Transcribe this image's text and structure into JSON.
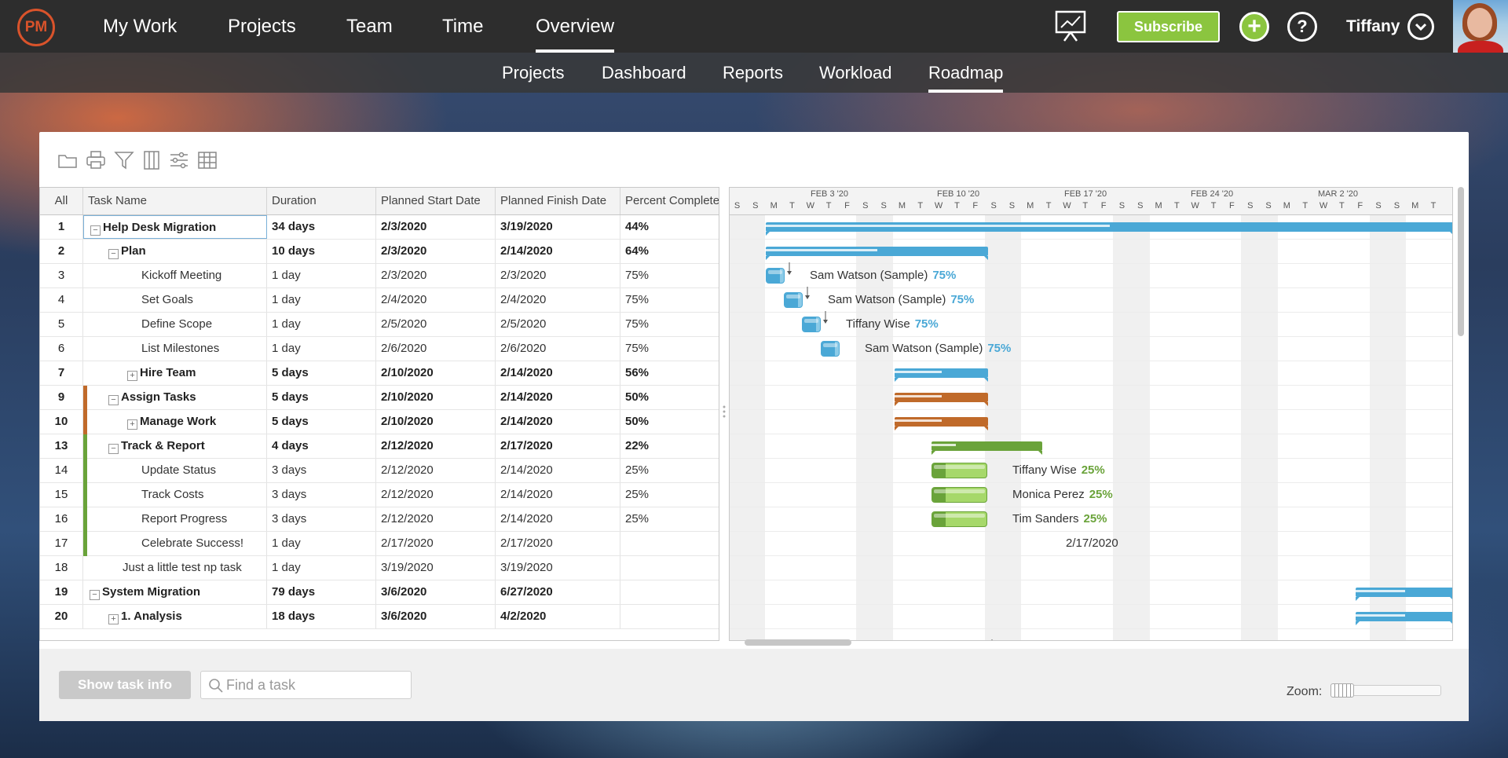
{
  "app": {
    "logo": "PM"
  },
  "topnav": {
    "items": [
      "My Work",
      "Projects",
      "Team",
      "Time",
      "Overview"
    ],
    "active": "Overview"
  },
  "header": {
    "subscribe": "Subscribe",
    "user_name": "Tiffany"
  },
  "subnav": {
    "items": [
      "Projects",
      "Dashboard",
      "Reports",
      "Workload",
      "Roadmap"
    ],
    "active": "Roadmap"
  },
  "toolbar": {
    "icons": [
      "folder-icon",
      "print-icon",
      "filter-icon",
      "columns-icon",
      "settings-sliders-icon",
      "table-icon"
    ]
  },
  "grid": {
    "columns": [
      "All",
      "Task Name",
      "Duration",
      "Planned Start Date",
      "Planned Finish Date",
      "Percent Complete"
    ],
    "rows": [
      {
        "id": "1",
        "name": "Help Desk Migration",
        "duration": "34 days",
        "start": "2/3/2020",
        "finish": "3/19/2020",
        "pct": "44%"
      },
      {
        "id": "2",
        "name": "Plan",
        "duration": "10 days",
        "start": "2/3/2020",
        "finish": "2/14/2020",
        "pct": "64%"
      },
      {
        "id": "3",
        "name": "Kickoff Meeting",
        "duration": "1 day",
        "start": "2/3/2020",
        "finish": "2/3/2020",
        "pct": "75%"
      },
      {
        "id": "4",
        "name": "Set Goals",
        "duration": "1 day",
        "start": "2/4/2020",
        "finish": "2/4/2020",
        "pct": "75%"
      },
      {
        "id": "5",
        "name": "Define Scope",
        "duration": "1 day",
        "start": "2/5/2020",
        "finish": "2/5/2020",
        "pct": "75%"
      },
      {
        "id": "6",
        "name": "List Milestones",
        "duration": "1 day",
        "start": "2/6/2020",
        "finish": "2/6/2020",
        "pct": "75%"
      },
      {
        "id": "7",
        "name": "Hire Team",
        "duration": "5 days",
        "start": "2/10/2020",
        "finish": "2/14/2020",
        "pct": "56%"
      },
      {
        "id": "9",
        "name": "Assign Tasks",
        "duration": "5 days",
        "start": "2/10/2020",
        "finish": "2/14/2020",
        "pct": "50%"
      },
      {
        "id": "10",
        "name": "Manage Work",
        "duration": "5 days",
        "start": "2/10/2020",
        "finish": "2/14/2020",
        "pct": "50%"
      },
      {
        "id": "13",
        "name": "Track & Report",
        "duration": "4 days",
        "start": "2/12/2020",
        "finish": "2/17/2020",
        "pct": "22%"
      },
      {
        "id": "14",
        "name": "Update Status",
        "duration": "3 days",
        "start": "2/12/2020",
        "finish": "2/14/2020",
        "pct": "25%"
      },
      {
        "id": "15",
        "name": "Track Costs",
        "duration": "3 days",
        "start": "2/12/2020",
        "finish": "2/14/2020",
        "pct": "25%"
      },
      {
        "id": "16",
        "name": "Report Progress",
        "duration": "3 days",
        "start": "2/12/2020",
        "finish": "2/14/2020",
        "pct": "25%"
      },
      {
        "id": "17",
        "name": "Celebrate Success!",
        "duration": "1 day",
        "start": "2/17/2020",
        "finish": "2/17/2020",
        "pct": ""
      },
      {
        "id": "18",
        "name": "Just a little test np task",
        "duration": "1 day",
        "start": "3/19/2020",
        "finish": "3/19/2020",
        "pct": ""
      },
      {
        "id": "19",
        "name": "System Migration",
        "duration": "79 days",
        "start": "3/6/2020",
        "finish": "6/27/2020",
        "pct": ""
      },
      {
        "id": "20",
        "name": "1. Analysis",
        "duration": "18 days",
        "start": "3/6/2020",
        "finish": "4/2/2020",
        "pct": ""
      }
    ]
  },
  "gantt": {
    "weeks": [
      "FEB 3 '20",
      "FEB 10 '20",
      "FEB 17 '20",
      "FEB 24 '20",
      "MAR 2 '20"
    ],
    "days": [
      "S",
      "S",
      "M",
      "T",
      "W",
      "T",
      "F",
      "S",
      "S",
      "M",
      "T",
      "W",
      "T",
      "F",
      "S",
      "S",
      "M",
      "T",
      "W",
      "T",
      "F",
      "S",
      "S",
      "M",
      "T",
      "W",
      "T",
      "F",
      "S",
      "S",
      "M",
      "T",
      "W",
      "T",
      "F",
      "S",
      "S",
      "M",
      "T"
    ],
    "labels": [
      {
        "name": "Sam Watson (Sample)",
        "pct": "75%"
      },
      {
        "name": "Sam Watson (Sample)",
        "pct": "75%"
      },
      {
        "name": "Tiffany Wise",
        "pct": "75%"
      },
      {
        "name": "Sam Watson (Sample)",
        "pct": "75%"
      },
      {
        "name": "Tiffany Wise",
        "pct": "25%"
      },
      {
        "name": "Monica Perez",
        "pct": "25%"
      },
      {
        "name": "Tim Sanders",
        "pct": "25%"
      }
    ],
    "milestone_label": "2/17/2020",
    "colors": {
      "blue": "#4aa8d6",
      "orange": "#c06a2a",
      "green": "#6aa33a",
      "lightgreen": "#a6d86a"
    }
  },
  "footer": {
    "show_task_info": "Show task info",
    "search_placeholder": "Find a task",
    "zoom_label": "Zoom:"
  }
}
